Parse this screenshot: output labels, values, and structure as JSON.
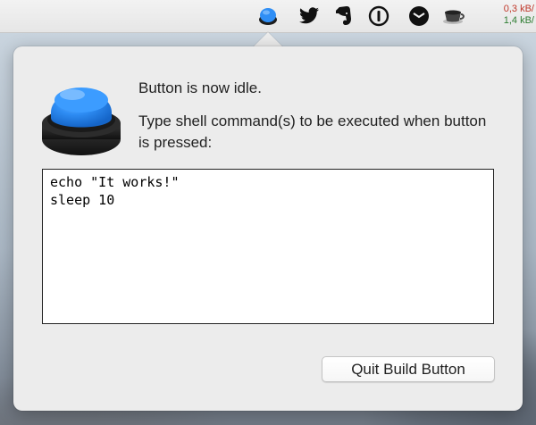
{
  "menubar": {
    "icons": [
      "blue-button-icon",
      "twitter-icon",
      "evernote-icon",
      "password-icon",
      "mail-icon",
      "coffee-cup-icon"
    ],
    "network": {
      "upload": "0,3 kB/",
      "download": "1,4 kB/"
    },
    "colors": {
      "upload": "#c0392b",
      "download": "#2e7d32"
    }
  },
  "popover": {
    "status": "Button is now idle.",
    "instructions": "Type shell command(s) to be executed when button is pressed:",
    "command": "echo \"It works!\"\nsleep 10",
    "quit_label": "Quit Build Button",
    "accent": "#2f8ef5"
  }
}
